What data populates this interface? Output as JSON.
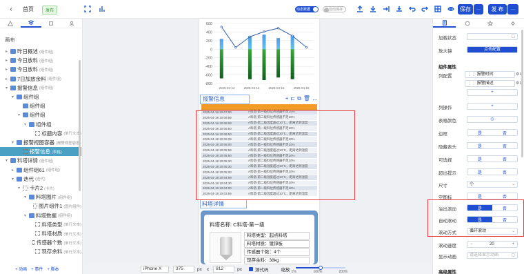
{
  "topbar": {
    "home_label": "首页",
    "status_badge": "发布",
    "toggle_dynamic_label": "动态数据",
    "toggle_auto_label": "自动保存",
    "save_label": "保存",
    "more_label": "···",
    "publish_label": "发 布",
    "publish_more": "···"
  },
  "left": {
    "panel_title": "画布",
    "tree": [
      {
        "label": "昨日概述",
        "tag": "(组件组)",
        "indent": 0,
        "arrow": "▸",
        "icon": "folder"
      },
      {
        "label": "今日放料",
        "tag": "(组件组)",
        "indent": 0,
        "arrow": "▸",
        "icon": "folder"
      },
      {
        "label": "今日放料",
        "tag": "(组件组)",
        "indent": 0,
        "arrow": "▸",
        "icon": "folder"
      },
      {
        "label": "7日加放余料",
        "tag": "(组件组)",
        "indent": 0,
        "arrow": "▸",
        "icon": "folder"
      },
      {
        "label": "报警信息",
        "tag": "(组件组)",
        "indent": 0,
        "arrow": "▾",
        "icon": "folder"
      },
      {
        "label": "组件组",
        "tag": "",
        "indent": 1,
        "arrow": "▾",
        "icon": "folder"
      },
      {
        "label": "组件组",
        "tag": "",
        "indent": 2,
        "arrow": "",
        "icon": "folder"
      },
      {
        "label": "组件组",
        "tag": "",
        "indent": 2,
        "arrow": "▾",
        "icon": "folder"
      },
      {
        "label": "组件组",
        "tag": "",
        "indent": 3,
        "arrow": "▾",
        "icon": "folder"
      },
      {
        "label": "标题内容",
        "tag": "(单行文本)",
        "indent": 4,
        "arrow": "",
        "icon": "grid"
      },
      {
        "label": "报警视图容器",
        "tag": "(报警视图容器)",
        "indent": 1,
        "arrow": "▾",
        "icon": "folder"
      },
      {
        "label": "报警信息",
        "tag": "(表格)",
        "indent": 2,
        "arrow": "",
        "icon": "grid",
        "selected": true
      },
      {
        "label": "料塔详情",
        "tag": "(组件组)",
        "indent": 0,
        "arrow": "▾",
        "icon": "folder"
      },
      {
        "label": "组件组61",
        "tag": "(组件组)",
        "indent": 1,
        "arrow": "▸",
        "icon": "folder"
      },
      {
        "label": "迭代",
        "tag": "(迭代)",
        "indent": 1,
        "arrow": "▾",
        "icon": "folder"
      },
      {
        "label": "卡片2",
        "tag": "(卡片)",
        "indent": 2,
        "arrow": "▾",
        "icon": "grid"
      },
      {
        "label": "料塔图片",
        "tag": "(组件组)",
        "indent": 3,
        "arrow": "▾",
        "icon": "folder"
      },
      {
        "label": "图片组件1",
        "tag": "(图片组件)",
        "indent": 4,
        "arrow": "",
        "icon": "grid"
      },
      {
        "label": "料塔数据",
        "tag": "(组件组)",
        "indent": 3,
        "arrow": "▾",
        "icon": "folder"
      },
      {
        "label": "料塔类型",
        "tag": "(单行文本)",
        "indent": 4,
        "arrow": "",
        "icon": "grid"
      },
      {
        "label": "料塔材质",
        "tag": "(单行文本)",
        "indent": 4,
        "arrow": "",
        "icon": "grid"
      },
      {
        "label": "传感器个数",
        "tag": "(单行文本)",
        "indent": 4,
        "arrow": "",
        "icon": "grid"
      },
      {
        "label": "现存余料",
        "tag": "(单行文本)",
        "indent": 4,
        "arrow": "",
        "icon": "grid"
      }
    ],
    "bottom_links": [
      "+ 动画",
      "+ 事件",
      "+ 脚本"
    ]
  },
  "canvas": {
    "alarm_title": "报警信息",
    "alarm_rows": [
      {
        "time": "2025-04-18 10:07:00",
        "desc": "A料塔-第一级料位传感器不足10%"
      },
      {
        "time": "2025-04-18 10:06:59",
        "desc": "A料塔-第二级料位传感器不足10%"
      },
      {
        "time": "2025-04-18 10:06:59",
        "desc": "A料塔-第二级温度超过10°C，距离达到温度"
      },
      {
        "time": "2025-04-18 10:06:50",
        "desc": "A料塔-第一级料位传感器不足10%"
      },
      {
        "time": "2025-04-18 10:06:50",
        "desc": "A料塔-第二级温度超过10°C，距离达到温度"
      },
      {
        "time": "2025-04-18 10:06:09",
        "desc": "A料塔-第二级料位传感器不足10%"
      },
      {
        "time": "2025-04-18 10:06:00",
        "desc": "A料塔-第一级料位传感器不足10%"
      },
      {
        "time": "2025-04-18 10:05:59",
        "desc": "A料塔-第二级温度超过10°C，距离达到温度"
      },
      {
        "time": "2025-04-18 10:05:50",
        "desc": "A料塔-第一级料位传感器不足10%"
      },
      {
        "time": "2025-04-18 10:05:30",
        "desc": "A料塔-第二级料位传感器不足10%"
      },
      {
        "time": "2025-04-18 10:05:30",
        "desc": "A料塔-第二级温度超过10°C，距离达到温度"
      },
      {
        "time": "2025-04-18 10:05:00",
        "desc": "A料塔-第一级料位传感器不足10%"
      },
      {
        "time": "2025-04-18 10:04:59",
        "desc": "A料塔-第二级温度超过10°C，距离达到温度"
      },
      {
        "time": "2025-04-18 10:04:30",
        "desc": "A料塔-第二级料位传感器不足10%"
      },
      {
        "time": "2025-04-18 10:04:00",
        "desc": "A料塔-第一级料位传感器不足10%"
      },
      {
        "time": "2025-04-18 10:03:59",
        "desc": "A料塔-第二级温度超过10°C，距离达到温度"
      }
    ],
    "tower_title": "料塔详情",
    "tower_name": "料塔名称:  C料塔-第一级",
    "tower_fields": [
      "料塔类型：起点料塔",
      "料塔材质：镀锌板",
      "传感器个数：4个",
      "现存余料：38kg"
    ]
  },
  "chart_data": {
    "type": "bar",
    "categories": [
      "2025-04-12",
      "2025-04-14",
      "2025-04-16",
      "2025-04-18"
    ],
    "x_tick_labels": [
      "2025-04-12",
      "2025-04-14",
      "2025-04-16",
      "2025-04-18"
    ],
    "ylim": [
      -800,
      600
    ],
    "yticks": [
      600,
      400,
      200,
      0,
      -200,
      -400,
      -600,
      -800
    ],
    "series": [
      {
        "type": "bar",
        "values": [
          240,
          0,
          310,
          340,
          260,
          320,
          0
        ]
      },
      {
        "type": "bar",
        "values": [
          -680,
          0,
          -700,
          -720,
          -660,
          -700,
          0
        ]
      },
      {
        "type": "line",
        "values": [
          520,
          40,
          290,
          410,
          490,
          310,
          40
        ]
      }
    ],
    "colors": {
      "bar_pos_top": "#4f9be8",
      "bar_pos_bottom": "#5fc0f0",
      "bar_neg_top": "#3aa63a",
      "bar_neg_bottom": "#0f5f1f",
      "line": "#2f5cb0"
    }
  },
  "bottombar": {
    "device": "iPhone X",
    "width": "375",
    "unit1": "px",
    "times": "x",
    "height": "812",
    "unit2": "px",
    "source_label": "源代码",
    "zoom_label": "缩放",
    "zoom_min": "1%",
    "zoom_mid": "100%",
    "zoom_max": "200%",
    "zoom_value": 0.5
  },
  "right": {
    "rows": {
      "load_state": "加载状态",
      "zoom_mode": "放大镜",
      "zoom_mode_button": "点击配置",
      "section_props": "组件属性",
      "columns": "列配置",
      "col_item_1": "报警时间",
      "col_item_2": "报警描述",
      "col_add": "+",
      "col_actions": "列操作",
      "col_actions_add": "+",
      "header_color": "表格颜色",
      "stripe": "边框",
      "hide_header": "隐藏表头",
      "selectable": "可选择",
      "overflow_tooltip": "超出提示",
      "size": "尺寸",
      "size_value": "小",
      "empty_mark": "空图标",
      "scroll_overflow": "溢出滚动",
      "auto_scroll": "自动滚动",
      "scroll_mode": "滚动方式",
      "scroll_mode_value": "循环滚动",
      "scroll_speed": "滚动速度",
      "scroll_speed_value": "20",
      "show_anim": "显示动画",
      "show_anim_placeholder": "请选择显示动画",
      "section_advanced": "高级属性",
      "yes": "是",
      "no": "否"
    }
  }
}
